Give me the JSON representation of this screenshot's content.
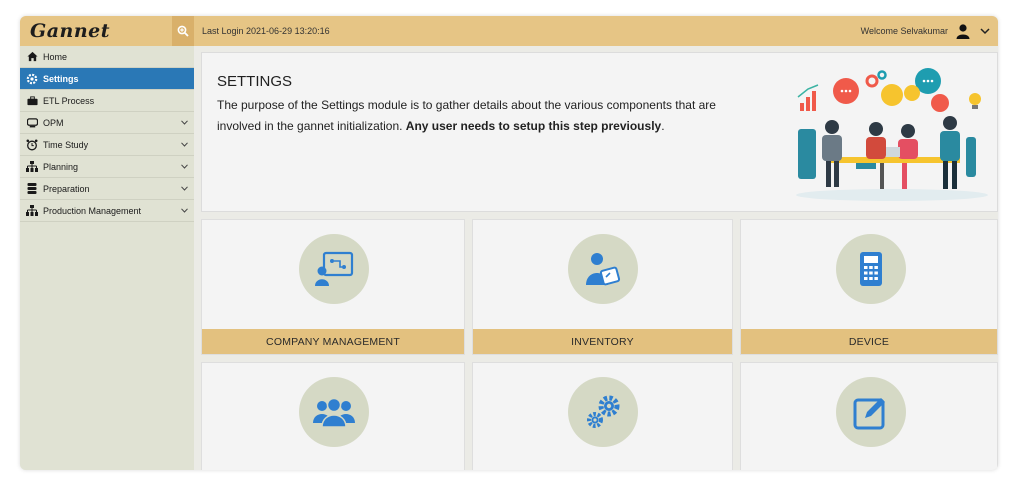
{
  "header": {
    "brand": "Gannet",
    "last_login": "Last Login 2021-06-29 13:20:16",
    "welcome": "Welcome Selvakumar"
  },
  "sidebar": {
    "items": [
      {
        "label": "Home",
        "icon": "home-icon",
        "active": false,
        "has_children": false
      },
      {
        "label": "Settings",
        "icon": "gear-icon",
        "active": true,
        "has_children": false
      },
      {
        "label": "ETL Process",
        "icon": "briefcase-icon",
        "active": false,
        "has_children": false
      },
      {
        "label": "OPM",
        "icon": "monitor-icon",
        "active": false,
        "has_children": true
      },
      {
        "label": "Time Study",
        "icon": "alarm-clock-icon",
        "active": false,
        "has_children": true
      },
      {
        "label": "Planning",
        "icon": "sitemap-icon",
        "active": false,
        "has_children": true
      },
      {
        "label": "Preparation",
        "icon": "database-icon",
        "active": false,
        "has_children": true
      },
      {
        "label": "Production Management",
        "icon": "sitemap-icon",
        "active": false,
        "has_children": true
      }
    ]
  },
  "hero": {
    "title": "SETTINGS",
    "text_normal": "The purpose of the Settings module is to gather details about the various components that are involved in the gannet initialization. ",
    "text_bold": "Any user needs to setup this step previously",
    "text_end": "."
  },
  "cards": [
    {
      "label": "COMPANY MANAGEMENT",
      "icon": "presentation-board-icon"
    },
    {
      "label": "INVENTORY",
      "icon": "person-clipboard-icon"
    },
    {
      "label": "DEVICE",
      "icon": "calculator-icon"
    },
    {
      "label": "",
      "icon": "users-group-icon"
    },
    {
      "label": "",
      "icon": "gears-icon"
    },
    {
      "label": "",
      "icon": "edit-icon"
    }
  ],
  "colors": {
    "accent_gold": "#e6c585",
    "active_blue": "#2a78b6",
    "icon_blue": "#2f7fd0",
    "circle_bg": "#d5d9c5"
  }
}
